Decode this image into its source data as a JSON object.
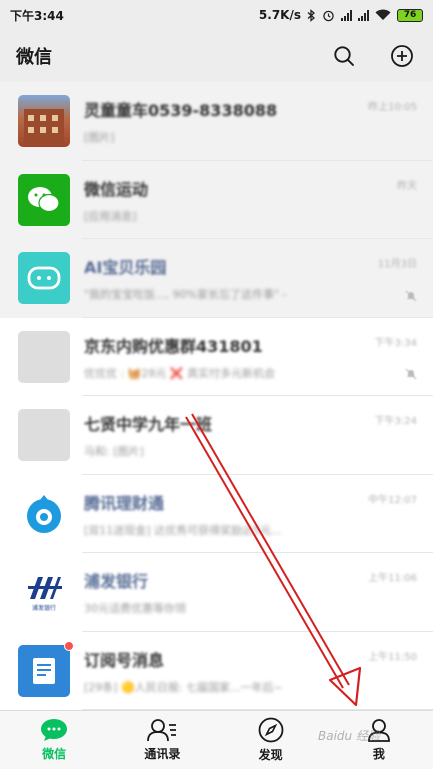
{
  "status_bar": {
    "time": "下午3:44",
    "speed": "5.7K/s",
    "battery": "76"
  },
  "header": {
    "title": "微信"
  },
  "chats": [
    {
      "title": "灵童童车0539-8338088",
      "preview": "[图片]",
      "time": "昨上10:05",
      "pinned": true,
      "title_color": "dark",
      "avatar": "photo-building"
    },
    {
      "title": "微信运动",
      "preview": "[应用消息]",
      "time": "昨天",
      "pinned": true,
      "title_color": "dark",
      "avatar": "wechat-sport"
    },
    {
      "title": "AI宝贝乐园",
      "preview": "\"我的宝宝吃饭..., 90%家长忘了这件事\" -",
      "time": "11月3日",
      "pinned": true,
      "title_color": "blue",
      "avatar": "ai-bot",
      "muted": true
    },
    {
      "title": "京东内购优惠群431801",
      "preview": "优优优 : 🧺28元 ❌ 真实付多元新机会",
      "time": "下午3:34",
      "pinned": false,
      "title_color": "dark",
      "avatar": "group-grid-a",
      "muted": true
    },
    {
      "title": "七贤中学九年一班",
      "preview": "马和: [图片]",
      "time": "下午3:24",
      "pinned": false,
      "title_color": "dark",
      "avatar": "group-grid-b"
    },
    {
      "title": "腾讯理财通",
      "preview": "[双11送现金] 达优秀可获得奖励达5元...",
      "time": "中午12:07",
      "pinned": false,
      "title_color": "blue",
      "avatar": "tencent-wealth"
    },
    {
      "title": "浦发银行",
      "preview": "30元话费优惠等你领",
      "time": "上午11:06",
      "pinned": false,
      "title_color": "blue",
      "avatar": "spd-bank"
    },
    {
      "title": "订阅号消息",
      "preview": "[29条] 🟡人民日报: 七届国家...一年后~",
      "time": "上午11:50",
      "pinned": false,
      "title_color": "dark",
      "avatar": "subscription",
      "unread_dot": true
    }
  ],
  "tabs": [
    {
      "label": "微信",
      "icon": "chat-bubble-icon",
      "active": true
    },
    {
      "label": "通讯录",
      "icon": "contacts-icon",
      "active": false
    },
    {
      "label": "发现",
      "icon": "compass-icon",
      "active": false
    },
    {
      "label": "我",
      "icon": "person-icon",
      "active": false
    }
  ],
  "watermark": "Baidu 经验",
  "colors": {
    "accent": "#07c160",
    "annotation_arrow": "#d42020",
    "link_blue": "#576b95"
  }
}
